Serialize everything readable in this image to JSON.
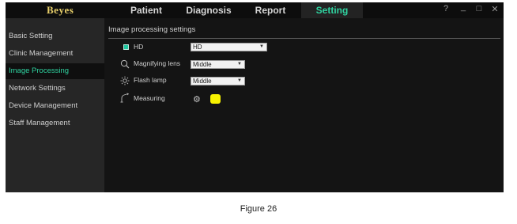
{
  "app": {
    "logo": "Beyes",
    "tabs": [
      {
        "label": "Patient"
      },
      {
        "label": "Diagnosis"
      },
      {
        "label": "Report"
      },
      {
        "label": "Setting"
      }
    ],
    "window_controls": {
      "help": "?",
      "minimize": "_",
      "maximize": "□",
      "close": "✕"
    }
  },
  "sidebar": {
    "items": [
      {
        "label": "Basic Setting"
      },
      {
        "label": "Clinic Management"
      },
      {
        "label": "Image Processing"
      },
      {
        "label": "Network Settings"
      },
      {
        "label": "Device Management"
      },
      {
        "label": "Staff Management"
      }
    ],
    "active_index": 2
  },
  "main": {
    "section_title": "Image processing settings",
    "hd": {
      "label": "HD",
      "checked": true,
      "value": "HD"
    },
    "magnifying_lens": {
      "label": "Magnifying lens",
      "value": "Middle"
    },
    "flash_lamp": {
      "label": "Flash lamp",
      "value": "Middle"
    },
    "measuring": {
      "label": "Measuring",
      "color": "#f7f200"
    }
  },
  "colors": {
    "accent": "#2fd3a0",
    "logo": "#e8cf6a",
    "measure_swatch": "#f7f200"
  },
  "caption": "Figure 26"
}
